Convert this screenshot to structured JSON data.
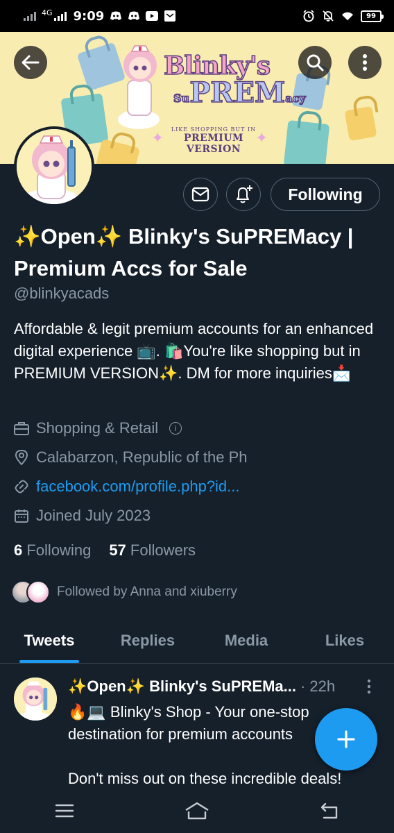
{
  "status_bar": {
    "network": "4G",
    "time": "9:09",
    "battery": "99",
    "left_icons": [
      "discord-icon",
      "discord-icon",
      "youtube-icon",
      "mail-icon"
    ],
    "right_icons": [
      "alarm-icon",
      "mute-icon",
      "wifi-icon"
    ]
  },
  "banner": {
    "brand_line1": "Blinky's",
    "brand_line2_prefix": "Su",
    "brand_line2_main": "PREM",
    "brand_line2_suffix": "acy",
    "tagline_small": "LIKE SHOPPING BUT IN",
    "tagline_big": "PREMIUM VERSION"
  },
  "profile": {
    "button_label": "Following",
    "name": "✨Open✨ Blinky's SuPREMacy | Premium Accs for Sale",
    "handle": "@blinkyacads",
    "bio": "Affordable & legit premium accounts for an enhanced digital experience 📺.   🛍️You're like shopping but in PREMIUM VERSION✨.  DM for more inquiries📩",
    "category": "Shopping & Retail",
    "location": "Calabarzon, Republic of the Ph",
    "link": "facebook.com/profile.php?id...",
    "joined": "Joined July 2023",
    "following_count": "6",
    "following_label": "Following",
    "followers_count": "57",
    "followers_label": "Followers",
    "followed_by": "Followed by Anna and xiuberry"
  },
  "tabs": [
    {
      "label": "Tweets",
      "active": true
    },
    {
      "label": "Replies",
      "active": false
    },
    {
      "label": "Media",
      "active": false
    },
    {
      "label": "Likes",
      "active": false
    }
  ],
  "tweet": {
    "name": "✨Open✨ Blinky's SuPREMa...",
    "time": "· 22h",
    "line1": "🔥💻 Blinky's Shop - Your one-stop",
    "line2": "destination for premium accounts",
    "line3": "Don't miss out on these incredible deals!"
  },
  "colors": {
    "background": "#15202b",
    "accent": "#1d9bf0",
    "secondary_text": "#8b98a5",
    "banner_bg": "#f8ecb0"
  }
}
